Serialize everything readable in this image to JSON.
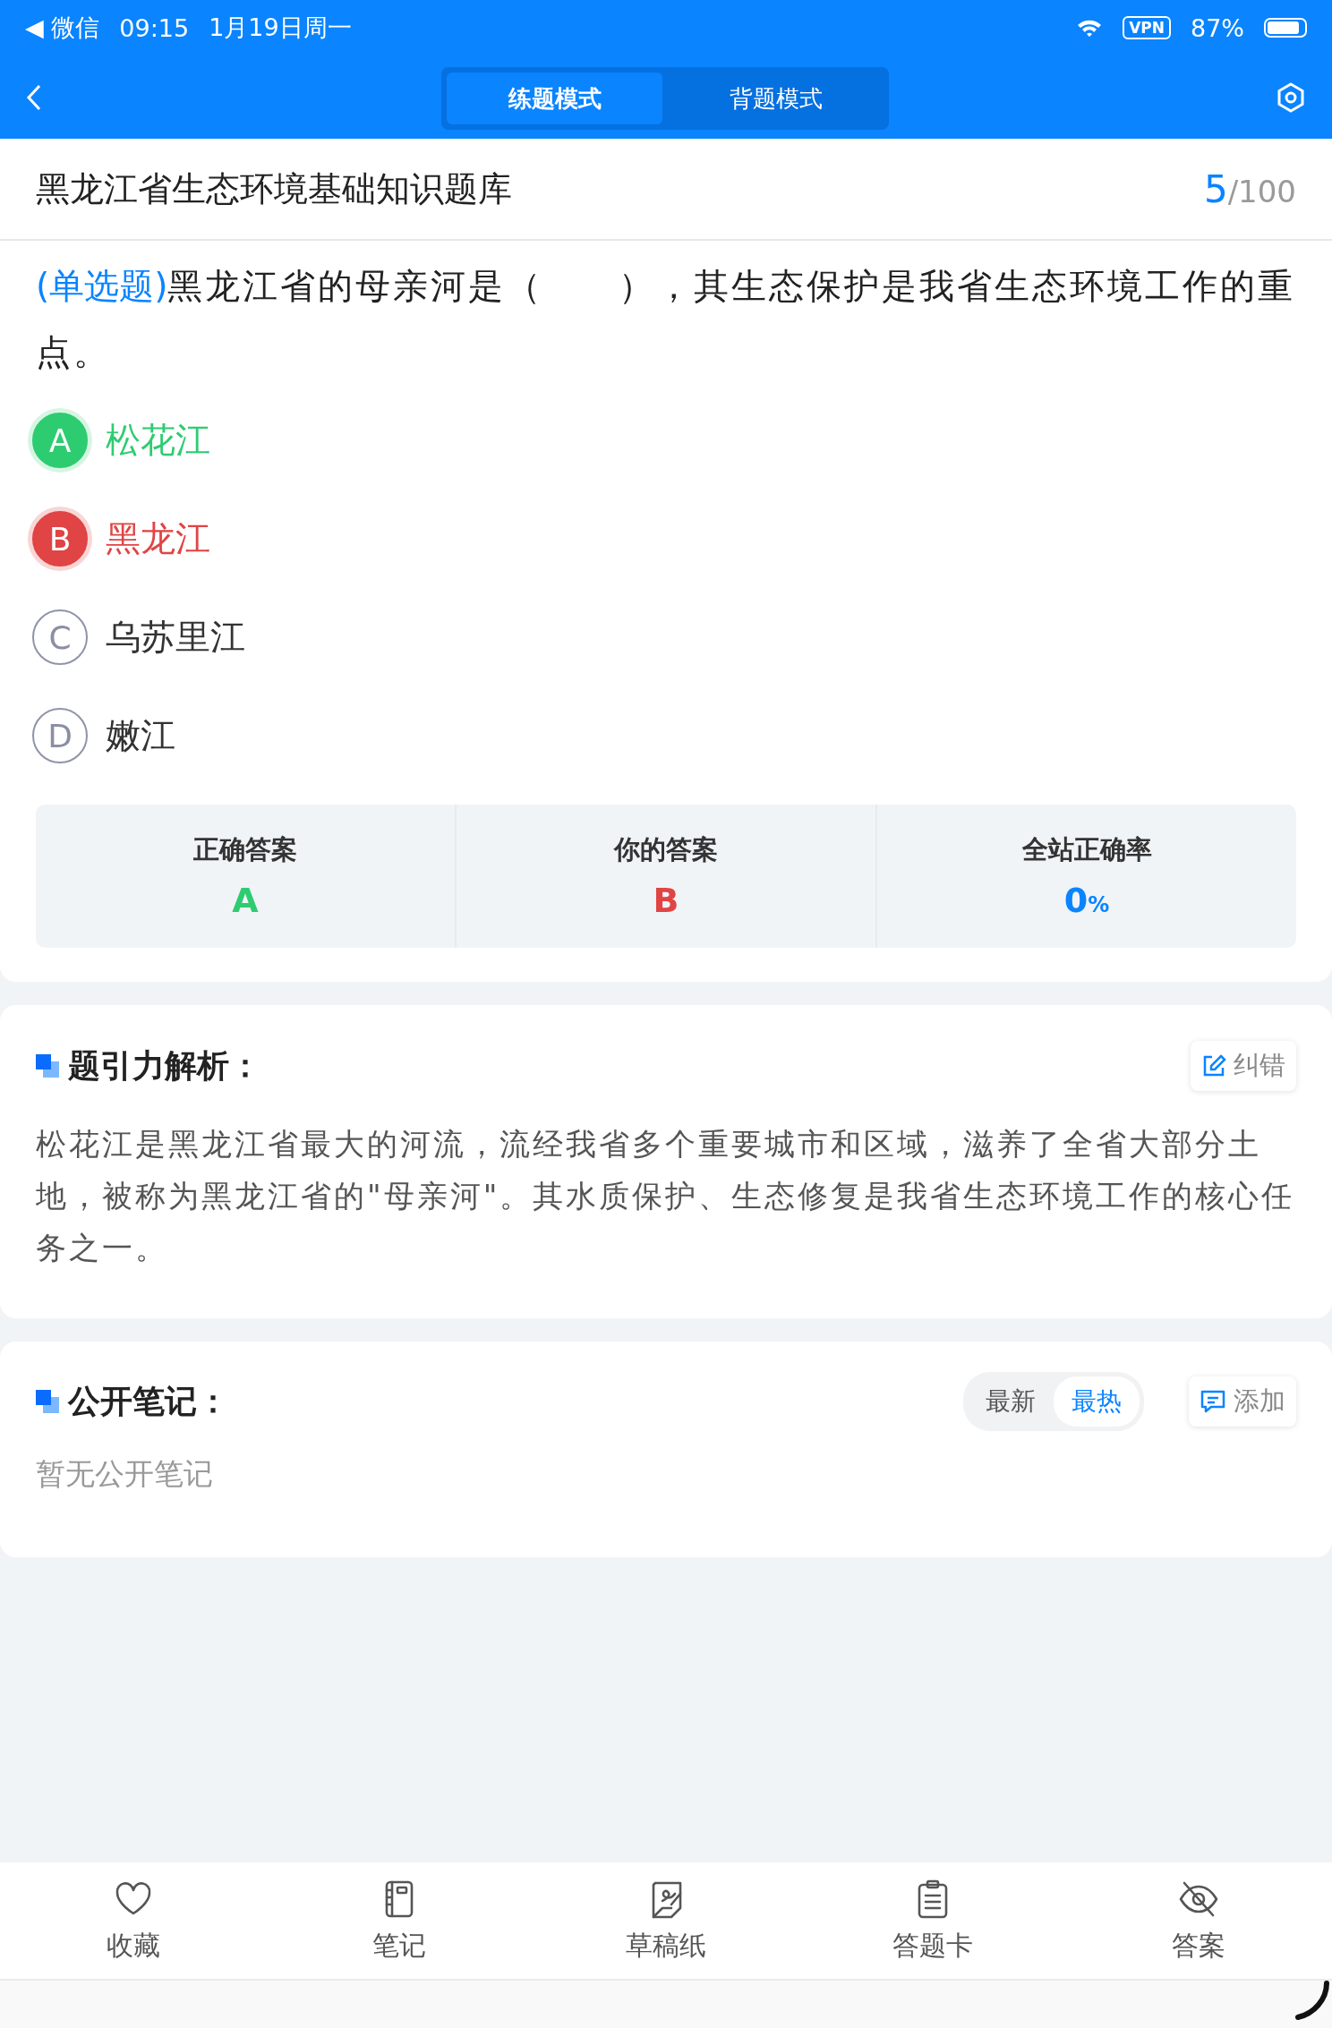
{
  "status_bar": {
    "back_app": "◀ 微信",
    "time": "09:15",
    "date": "1月19日周一",
    "vpn": "VPN",
    "battery": "87%"
  },
  "header": {
    "tabs": [
      {
        "label": "练题模式",
        "selected": true
      },
      {
        "label": "背题模式",
        "selected": false
      }
    ]
  },
  "title": "黑龙江省生态环境基础知识题库",
  "progress": {
    "current": "5",
    "total": "/100"
  },
  "question": {
    "type_label": "(单选题)",
    "text": "黑龙江省的母亲河是（　　），其生态保护是我省生态环境工作的重点。",
    "options": [
      {
        "letter": "A",
        "text": "松花江",
        "kind": "correct"
      },
      {
        "letter": "B",
        "text": "黑龙江",
        "kind": "wrong"
      },
      {
        "letter": "C",
        "text": "乌苏里江",
        "kind": "plain"
      },
      {
        "letter": "D",
        "text": "嫩江",
        "kind": "plain"
      }
    ]
  },
  "stats": [
    {
      "label": "正确答案",
      "value": "A",
      "kind": "correct"
    },
    {
      "label": "你的答案",
      "value": "B",
      "kind": "wrong"
    },
    {
      "label": "全站正确率",
      "value": "0",
      "unit": "%",
      "kind": "rate"
    }
  ],
  "analysis": {
    "heading": "题引力解析：",
    "action": "纠错",
    "text": "松花江是黑龙江省最大的河流，流经我省多个重要城市和区域，滋养了全省大部分土地，被称为黑龙江省的\"母亲河\"。其水质保护、生态修复是我省生态环境工作的核心任务之一。"
  },
  "notes": {
    "heading": "公开笔记：",
    "sort": [
      {
        "label": "最新",
        "selected": false
      },
      {
        "label": "最热",
        "selected": true
      }
    ],
    "action": "添加",
    "empty": "暂无公开笔记"
  },
  "bottom_bar": [
    {
      "label": "收藏",
      "kind": "heart"
    },
    {
      "label": "笔记",
      "kind": "notebook"
    },
    {
      "label": "草稿纸",
      "kind": "draft"
    },
    {
      "label": "答题卡",
      "kind": "clipboard"
    },
    {
      "label": "答案",
      "kind": "eye-off"
    }
  ]
}
